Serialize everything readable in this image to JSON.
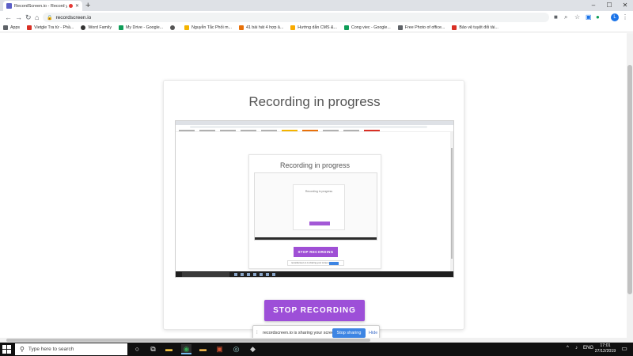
{
  "browser": {
    "tab_title": "RecordScreen.io - Record yo...",
    "tab_close": "✕",
    "new_tab": "+",
    "window_controls": [
      "–",
      "☐",
      "✕"
    ],
    "url": "recordscreen.io",
    "profile_initial": "L"
  },
  "bookmarks": [
    {
      "label": "Apps",
      "color": "#5f6368"
    },
    {
      "label": "Vietgle Tra từ - Phầ...",
      "color": "#d93025"
    },
    {
      "label": "Word Family",
      "color": "#333333"
    },
    {
      "label": "My Drive - Google...",
      "color": "#0f9d58"
    },
    {
      "label": "",
      "color": "#555555"
    },
    {
      "label": "Nguyễn Tắc Phối m...",
      "color": "#f4b400"
    },
    {
      "label": "41 bài hát 4 hợp â...",
      "color": "#e8710a"
    },
    {
      "label": "Hướng dẫn CMS &...",
      "color": "#f9ab00"
    },
    {
      "label": "Cong viec - Google...",
      "color": "#0f9d58"
    },
    {
      "label": "Free Photo of office...",
      "color": "#5f6368"
    },
    {
      "label": "Bảo vệ tuyệt đối tài...",
      "color": "#d93025"
    }
  ],
  "page": {
    "title": "Recording in progress",
    "stop_button": "STOP RECORDING",
    "preview": {
      "title": "Recording in progress",
      "inner_title": "Recording in progress",
      "stop_button": "STOP RECORDING",
      "notice_text": "recordscreen.io is sharing your screen."
    }
  },
  "share_bar": {
    "grip": "⁞",
    "text": "recordscreen.io is sharing your screen.",
    "stop_label": "Stop sharing",
    "hide_label": "Hide"
  },
  "taskbar": {
    "search_placeholder": "Type here to search",
    "language": "ENG",
    "time": "17:01",
    "date": "27/12/2019"
  },
  "colors": {
    "accent_purple": "#9d4fd8",
    "share_blue": "#3d85e3",
    "taskbar_bg": "#101010"
  }
}
